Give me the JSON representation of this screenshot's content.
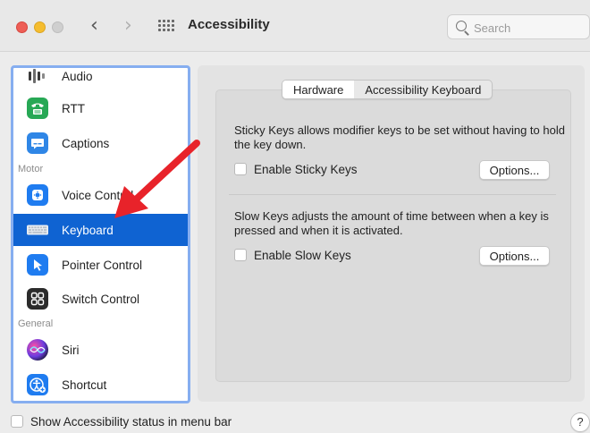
{
  "window": {
    "title": "Accessibility",
    "back_glyph": "‹",
    "forward_glyph": "›"
  },
  "search": {
    "placeholder": "Search"
  },
  "sidebar": {
    "items": [
      {
        "label": "Audio",
        "icon": "audio-icon"
      },
      {
        "label": "RTT",
        "icon": "rtt-icon"
      },
      {
        "label": "Captions",
        "icon": "captions-icon"
      },
      {
        "label": "Voice Control",
        "icon": "voice-control-icon"
      },
      {
        "label": "Keyboard",
        "icon": "keyboard-icon",
        "selected": true
      },
      {
        "label": "Pointer Control",
        "icon": "pointer-icon"
      },
      {
        "label": "Switch Control",
        "icon": "switch-control-icon"
      },
      {
        "label": "Siri",
        "icon": "siri-icon"
      },
      {
        "label": "Shortcut",
        "icon": "shortcut-icon"
      }
    ],
    "sections": {
      "motor": "Motor",
      "general": "General"
    }
  },
  "tabs": [
    {
      "label": "Hardware",
      "active": true
    },
    {
      "label": "Accessibility Keyboard",
      "active": false
    }
  ],
  "sticky_keys": {
    "description": "Sticky Keys allows modifier keys to be set without having to hold the key down.",
    "checkbox_label": "Enable Sticky Keys",
    "checked": false,
    "options_label": "Options..."
  },
  "slow_keys": {
    "description": "Slow Keys adjusts the amount of time between when a key is pressed and when it is activated.",
    "checkbox_label": "Enable Slow Keys",
    "checked": false,
    "options_label": "Options..."
  },
  "footer": {
    "status_label": "Show Accessibility status in menu bar",
    "status_checked": false,
    "help_label": "?"
  },
  "colors": {
    "selection": "#0f63d2",
    "focus_ring": "#86aef0",
    "annotation_arrow": "#e8232a"
  }
}
